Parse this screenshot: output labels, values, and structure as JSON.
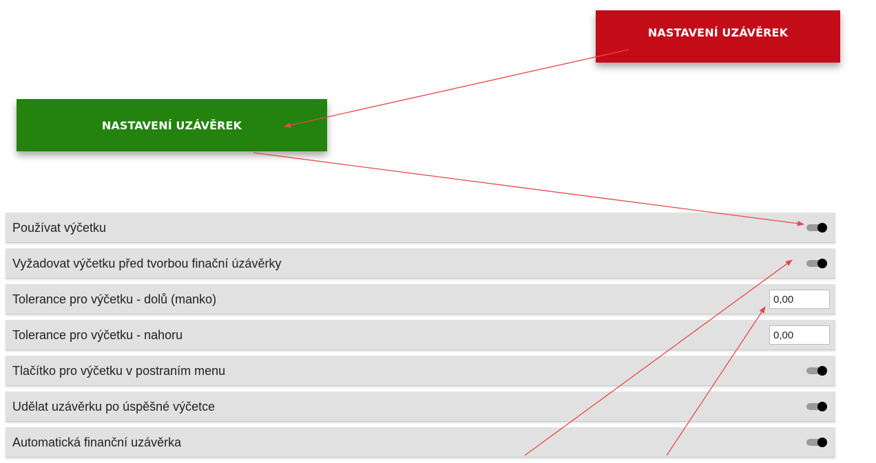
{
  "buttons": {
    "top_right_label": "NASTAVENÍ UZÁVĚREK",
    "left_label": "NASTAVENÍ UZÁVĚREK"
  },
  "colors": {
    "top_right_button": "#c40c18",
    "left_button": "#23830e",
    "annotation_arrow": "#e8474a",
    "row_background": "#e1e1e1"
  },
  "settings": [
    {
      "label": "Používat výčetku",
      "control": "toggle",
      "checked": true
    },
    {
      "label": "Vyžadovat výčetku před tvorbou finační úzávěrky",
      "control": "toggle",
      "checked": true
    },
    {
      "label": "Tolerance pro výčetku - dolů (manko)",
      "control": "input",
      "value": "0,00"
    },
    {
      "label": "Tolerance pro výčetku - nahoru",
      "control": "input",
      "value": "0,00"
    },
    {
      "label": "Tlačítko pro výčetku v postraním menu",
      "control": "toggle",
      "checked": true
    },
    {
      "label": "Udělat uzávěrku po úspěšné výčetce",
      "control": "toggle",
      "checked": true
    },
    {
      "label": "Automatická finanční uzávěrka",
      "control": "toggle",
      "checked": true
    }
  ]
}
